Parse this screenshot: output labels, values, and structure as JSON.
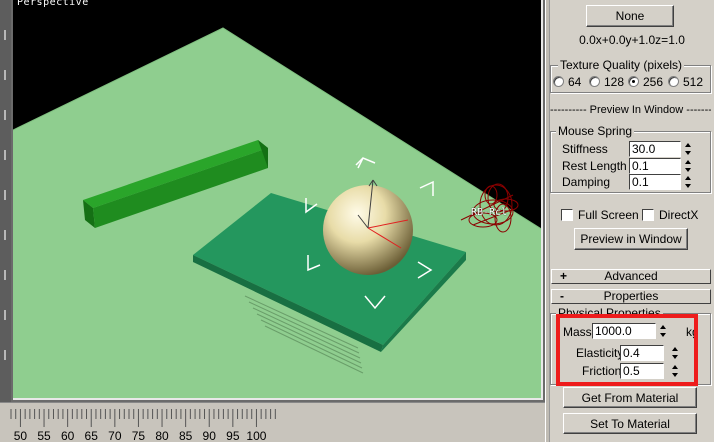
{
  "viewport": {
    "label": "Perspective",
    "ragdoll_label": "RB-Rcl"
  },
  "timeline": {
    "ticks": [
      "50",
      "55",
      "60",
      "65",
      "70",
      "75",
      "80",
      "85",
      "90",
      "95",
      "100"
    ]
  },
  "panel": {
    "none_button": "None",
    "vector_readout": "0.0x+0.0y+1.0z=1.0",
    "texture_quality": {
      "title": "Texture Quality (pixels)",
      "options": [
        "64",
        "128",
        "256",
        "512"
      ],
      "selected": "256"
    },
    "preview_header": "---------- Preview In Window ---------",
    "mouse_spring": {
      "title": "Mouse Spring",
      "stiffness_label": "Stiffness",
      "stiffness": "30.0",
      "rest_length_label": "Rest Length",
      "rest_length": "0.1",
      "damping_label": "Damping",
      "damping": "0.1"
    },
    "full_screen_label": "Full Screen",
    "directx_label": "DirectX",
    "preview_button": "Preview in Window",
    "rollout_advanced": {
      "sign": "+",
      "title": "Advanced"
    },
    "rollout_properties": {
      "sign": "-",
      "title": "Properties"
    },
    "physical_properties": {
      "title": "Physical Properties",
      "mass_label": "Mass",
      "mass": "1000.0",
      "mass_unit": "kg",
      "elasticity_label": "Elasticity",
      "elasticity": "0.4",
      "friction_label": "Friction",
      "friction": "0.5"
    },
    "get_from_material": "Get From Material",
    "set_to_material": "Set To Material"
  },
  "colors": {
    "ground": "#8fce8f",
    "platform": "#20905a",
    "bar": "#1f8c1f",
    "highlight": "#ee1c1c"
  }
}
